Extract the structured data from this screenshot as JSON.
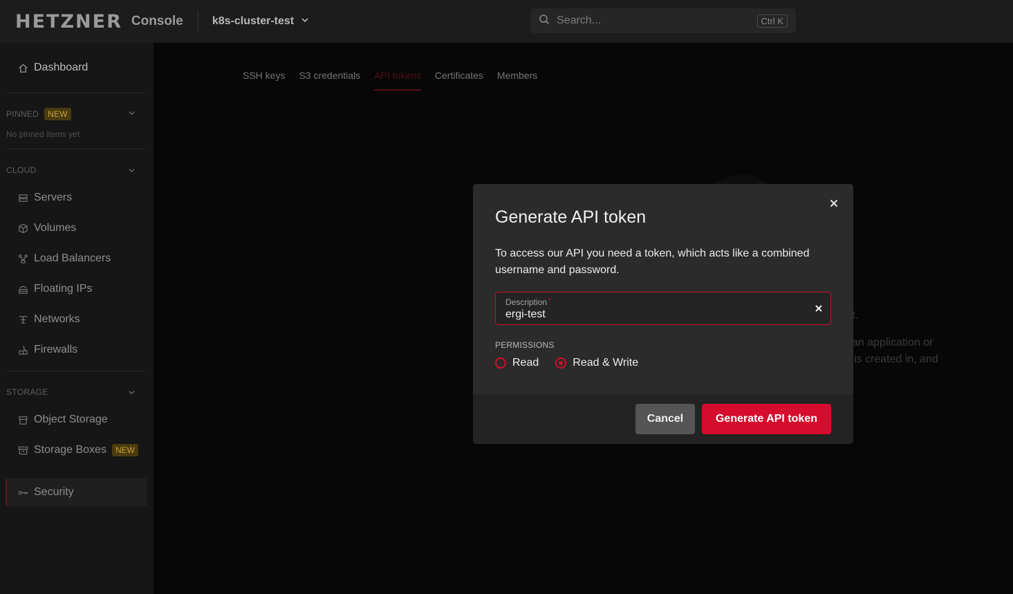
{
  "topbar": {
    "logo": "HETZNER",
    "console_label": "Console",
    "project_name": "k8s-cluster-test",
    "search_placeholder": "Search...",
    "search_shortcut": "Ctrl K"
  },
  "sidebar": {
    "dashboard": "Dashboard",
    "pinned_header": "PINNED",
    "pinned_badge": "NEW",
    "pinned_empty": "No pinned items yet",
    "cloud_header": "CLOUD",
    "cloud_items": [
      "Servers",
      "Volumes",
      "Load Balancers",
      "Floating IPs",
      "Networks",
      "Firewalls"
    ],
    "storage_header": "STORAGE",
    "storage_items": [
      "Object Storage",
      "Storage Boxes"
    ],
    "storage_boxes_badge": "NEW",
    "security": "Security"
  },
  "tabs": [
    "SSH keys",
    "S3 credentials",
    "API tokens",
    "Certificates",
    "Members"
  ],
  "active_tab": "API tokens",
  "background_fragments": {
    "line1": "t.",
    "line2": "an application or",
    "line3": "is created in, and"
  },
  "modal": {
    "title": "Generate API token",
    "description": "To access our API you need a token, which acts like a combined username and password.",
    "field_label": "Description",
    "field_required_mark": "*",
    "field_value": "ergi-test",
    "permissions_label": "PERMISSIONS",
    "permission_options": [
      "Read",
      "Read & Write"
    ],
    "selected_permission": "Read & Write",
    "cancel_label": "Cancel",
    "submit_label": "Generate API token"
  },
  "colors": {
    "accent": "#d50c2d",
    "active_tab": "#7a1a24",
    "badge_bg": "#4a3b10",
    "badge_text": "#c6a23a"
  }
}
